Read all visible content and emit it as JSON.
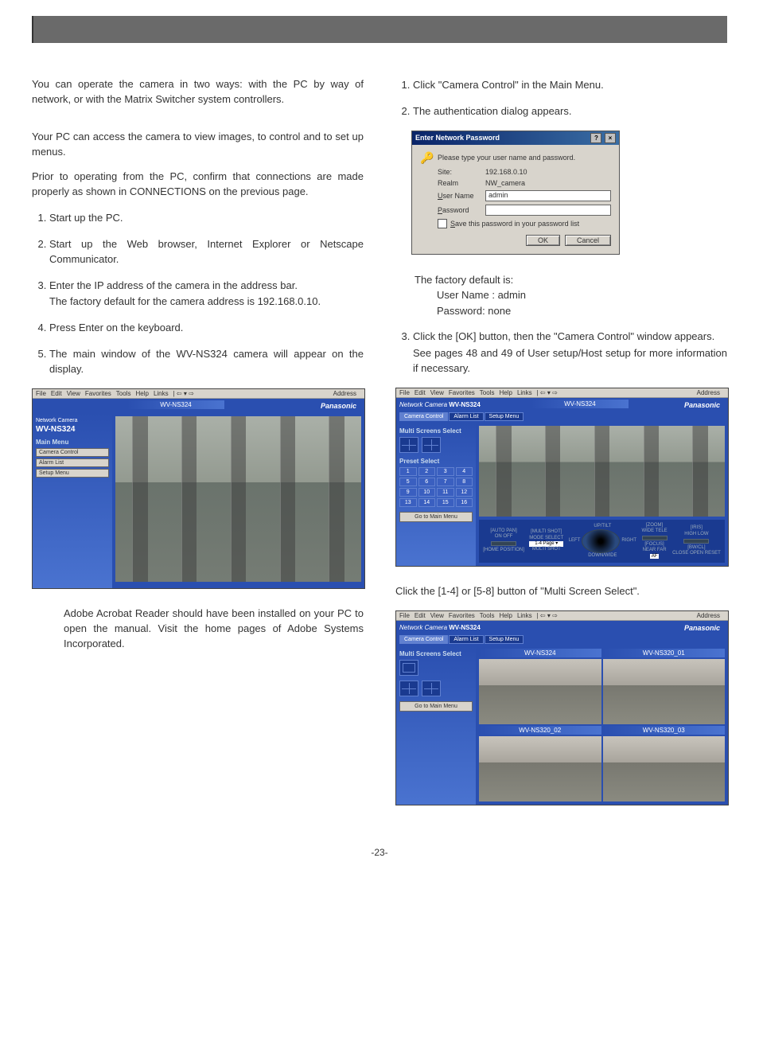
{
  "intro": "You can operate the camera in two ways: with the PC by way of network, or with the Matrix Switcher system controllers.",
  "pc_access": "Your PC can access the camera to view images, to control and to set up menus.",
  "pc_prior": "Prior to operating from the PC, confirm that connections are made properly as shown in CONNECTIONS on the previous page.",
  "left_steps": {
    "s1": "Start up the PC.",
    "s2": "Start up the Web browser, Internet Explorer or Netscape Communicator.",
    "s3": "Enter the IP address of the camera in the address bar.",
    "s3b": "The factory default for the camera address is 192.168.0.10.",
    "s4": "Press Enter on the keyboard.",
    "s5": "The main window of the WV-NS324 camera will appear on the display."
  },
  "note_acrobat": "Adobe Acrobat Reader should have been installed on your PC to open the manual. Visit the home pages of Adobe Systems Incorporated.",
  "right_steps": {
    "s1": "Click \"Camera Control\" in the Main Menu.",
    "s2": "The authentication dialog appears.",
    "s3a": "Click the [OK] button, then the \"Camera Control\" window appears.",
    "s3b": "See pages 48 and 49 of User setup/Host setup for more information if necessary."
  },
  "dialog": {
    "title": "Enter Network Password",
    "prompt": "Please type your user name and password.",
    "site_label": "Site:",
    "site_val": "192.168.0.10",
    "realm_label": "Realm",
    "realm_val": "NW_camera",
    "user_label": "User Name",
    "user_val": "admin",
    "pass_label": "Password",
    "save": "Save this password in your password list",
    "ok": "OK",
    "cancel": "Cancel"
  },
  "factory": {
    "head": "The factory default is:",
    "user": "User Name : admin",
    "pass": "Password: none"
  },
  "multiscreen_hint": "Click the [1-4] or [5-8] button of \"Multi Screen Select\".",
  "browser": {
    "menu": [
      "File",
      "Edit",
      "View",
      "Favorites",
      "Tools",
      "Help"
    ],
    "links": "Links",
    "address": "Address",
    "logo": "Network Camera",
    "model": "WV-NS324",
    "mainmenu": "Main Menu",
    "btns": [
      "Camera Control",
      "Alarm List",
      "Setup Menu"
    ],
    "brand": "Panasonic",
    "camlabel": "WV-NS324",
    "multiscreen": "Multi Screens Select",
    "preset": "Preset Select",
    "gomain": "Go to Main Menu",
    "tabs": [
      "Camera Control",
      "Alarm List",
      "Setup Menu"
    ],
    "ctrl": {
      "autopan": "[AUTO PAN]",
      "autopan2": "ON   OFF",
      "multishot": "[MULTI SHOT]",
      "shotsel": "MODE SELECT",
      "shotopt": "1-4 Page",
      "home": "[HOME POSITION]",
      "multishot2": "MULTI SHOT",
      "up": "UP/TILT",
      "left": "LEFT",
      "right": "RIGHT",
      "down": "DOWN/WIDE",
      "zoom": "[ZOOM]",
      "zoom2": "WIDE  TELE",
      "focus": "[FOCUS]",
      "focus2": "NEAR  FAR",
      "iris": "[IRIS]",
      "iris2": "HIGH  LOW",
      "bw": "[BW/CL]",
      "bw2": "CLOSE OPEN RESET",
      "af": "AF"
    },
    "quad": [
      "WV-NS324",
      "WV-NS320_01",
      "WV-NS320_02",
      "WV-NS320_03"
    ]
  },
  "presets": [
    "1",
    "2",
    "3",
    "4",
    "5",
    "6",
    "7",
    "8",
    "9",
    "10",
    "11",
    "12",
    "13",
    "14",
    "15",
    "16"
  ],
  "page": "-23-"
}
